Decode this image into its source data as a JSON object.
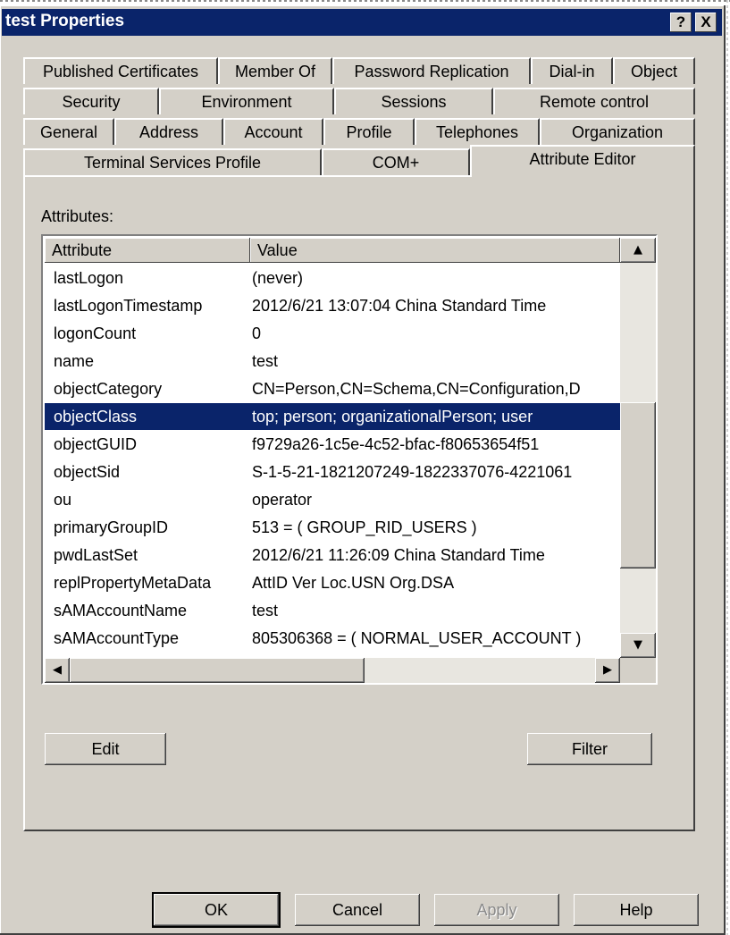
{
  "window": {
    "title": "test Properties",
    "help_btn": "?",
    "close_btn": "X"
  },
  "tabs": {
    "row1": [
      "Published Certificates",
      "Member Of",
      "Password Replication",
      "Dial-in",
      "Object"
    ],
    "row2": [
      "Security",
      "Environment",
      "Sessions",
      "Remote control"
    ],
    "row3": [
      "General",
      "Address",
      "Account",
      "Profile",
      "Telephones",
      "Organization"
    ],
    "row4": [
      "Terminal Services Profile",
      "COM+",
      "Attribute Editor"
    ],
    "active": "Attribute Editor"
  },
  "attributes": {
    "label": "Attributes:",
    "columns": [
      "Attribute",
      "Value"
    ],
    "rows": [
      {
        "attribute": "lastLogon",
        "value": "(never)"
      },
      {
        "attribute": "lastLogonTimestamp",
        "value": "2012/6/21 13:07:04 China Standard Time"
      },
      {
        "attribute": "logonCount",
        "value": "0"
      },
      {
        "attribute": "name",
        "value": "test"
      },
      {
        "attribute": "objectCategory",
        "value": "CN=Person,CN=Schema,CN=Configuration,D"
      },
      {
        "attribute": "objectClass",
        "value": "top; person; organizationalPerson; user"
      },
      {
        "attribute": "objectGUID",
        "value": "f9729a26-1c5e-4c52-bfac-f80653654f51"
      },
      {
        "attribute": "objectSid",
        "value": "S-1-5-21-1821207249-1822337076-4221061"
      },
      {
        "attribute": "ou",
        "value": "operator"
      },
      {
        "attribute": "primaryGroupID",
        "value": "513 = ( GROUP_RID_USERS )"
      },
      {
        "attribute": "pwdLastSet",
        "value": "2012/6/21 11:26:09 China Standard Time"
      },
      {
        "attribute": "replPropertyMetaData",
        "value": "AttID  Ver   Loc.USN               Org.DSA"
      },
      {
        "attribute": "sAMAccountName",
        "value": "test"
      },
      {
        "attribute": "sAMAccountType",
        "value": "805306368 = ( NORMAL_USER_ACCOUNT )"
      }
    ],
    "selected": "objectClass"
  },
  "buttons": {
    "edit": "Edit",
    "filter": "Filter",
    "ok": "OK",
    "cancel": "Cancel",
    "apply": "Apply",
    "help": "Help"
  },
  "colors": {
    "titlebar": "#0a246a",
    "face": "#d4d0c8",
    "selection": "#0a246a"
  }
}
